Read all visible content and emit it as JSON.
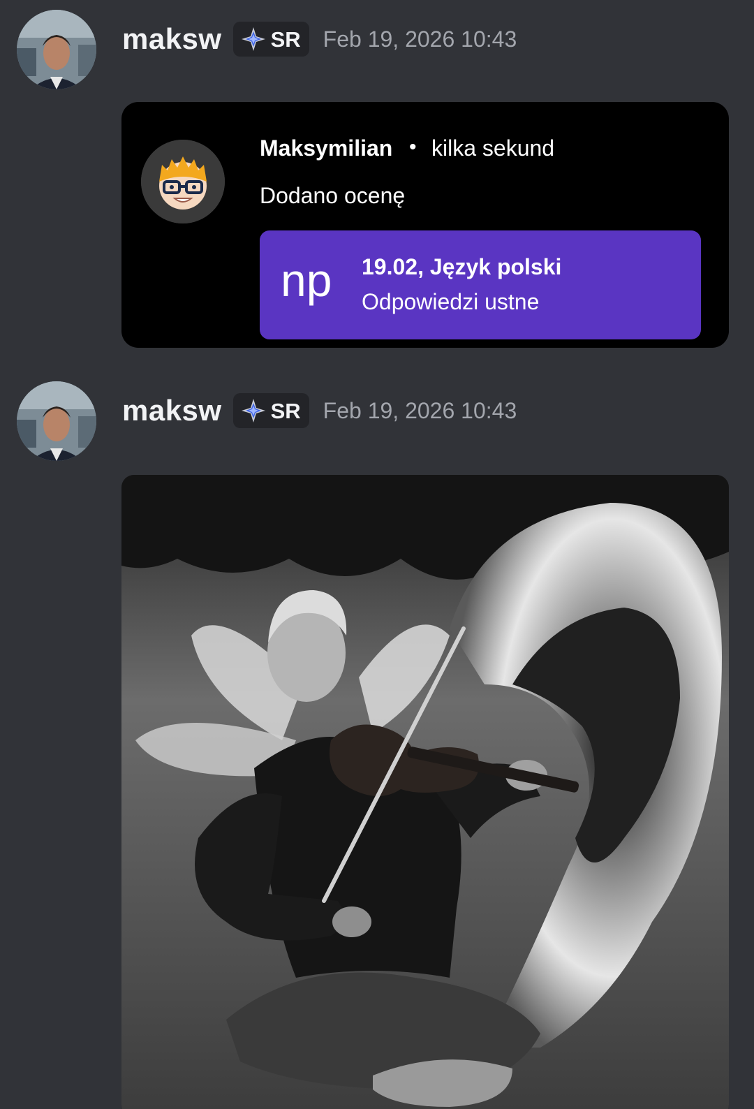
{
  "messages": [
    {
      "username": "maksw",
      "tag": "SR",
      "timestamp": "Feb 19, 2026 10:43",
      "embed": {
        "sender": "Maksymilian",
        "separator": "•",
        "time_ago": "kilka sekund",
        "text": "Dodano ocenę",
        "grade": {
          "value": "np",
          "title": "19.02, Język polski",
          "subtitle": "Odpowiedzi ustne"
        }
      }
    },
    {
      "username": "maksw",
      "tag": "SR",
      "timestamp": "Feb 19, 2026 10:43"
    }
  ],
  "colors": {
    "background": "#313338",
    "grade_box": "#5a35c2",
    "embed_background": "#000000",
    "timestamp": "#a3a6ad"
  }
}
